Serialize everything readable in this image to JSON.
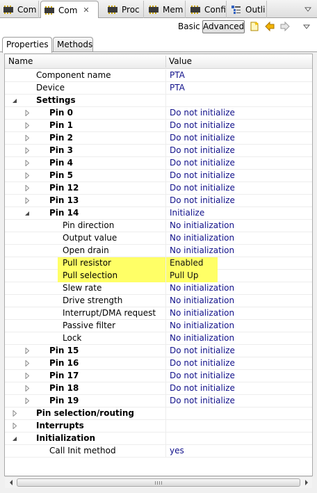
{
  "tabs": [
    {
      "label": "Com",
      "active": false
    },
    {
      "label": "Com",
      "active": true
    },
    {
      "label": "Proc",
      "active": false
    },
    {
      "label": "Mem",
      "active": false
    },
    {
      "label": "Confi",
      "active": false
    },
    {
      "label": "Outli",
      "active": false
    }
  ],
  "toolbar": {
    "basic_label": "Basic",
    "advanced_label": "Advanced"
  },
  "inner_tabs": [
    {
      "label": "Properties",
      "active": true
    },
    {
      "label": "Methods",
      "active": false
    }
  ],
  "table": {
    "columns": [
      "Name",
      "Value"
    ],
    "rows": [
      {
        "name": "Component name",
        "value": "PTA",
        "level": 1,
        "bold": false,
        "twisty": "none"
      },
      {
        "name": "Device",
        "value": "PTA",
        "level": 1,
        "bold": false,
        "twisty": "none"
      },
      {
        "name": "Settings",
        "value": "",
        "level": 1,
        "bold": true,
        "twisty": "expanded"
      },
      {
        "name": "Pin 0",
        "value": "Do not initialize",
        "level": 2,
        "bold": true,
        "twisty": "collapsed"
      },
      {
        "name": "Pin 1",
        "value": "Do not initialize",
        "level": 2,
        "bold": true,
        "twisty": "collapsed"
      },
      {
        "name": "Pin 2",
        "value": "Do not initialize",
        "level": 2,
        "bold": true,
        "twisty": "collapsed"
      },
      {
        "name": "Pin 3",
        "value": "Do not initialize",
        "level": 2,
        "bold": true,
        "twisty": "collapsed"
      },
      {
        "name": "Pin 4",
        "value": "Do not initialize",
        "level": 2,
        "bold": true,
        "twisty": "collapsed"
      },
      {
        "name": "Pin 5",
        "value": "Do not initialize",
        "level": 2,
        "bold": true,
        "twisty": "collapsed"
      },
      {
        "name": "Pin 12",
        "value": "Do not initialize",
        "level": 2,
        "bold": true,
        "twisty": "collapsed"
      },
      {
        "name": "Pin 13",
        "value": "Do not initialize",
        "level": 2,
        "bold": true,
        "twisty": "collapsed"
      },
      {
        "name": "Pin 14",
        "value": "Initialize",
        "level": 2,
        "bold": true,
        "twisty": "expanded"
      },
      {
        "name": "Pin direction",
        "value": "No initialization",
        "level": 3,
        "bold": false,
        "twisty": "none"
      },
      {
        "name": "Output value",
        "value": "No initialization",
        "level": 3,
        "bold": false,
        "twisty": "none"
      },
      {
        "name": "Open drain",
        "value": "No initialization",
        "level": 3,
        "bold": false,
        "twisty": "none"
      },
      {
        "name": "Pull resistor",
        "value": "Enabled",
        "level": 3,
        "bold": false,
        "twisty": "none",
        "highlight": true
      },
      {
        "name": "Pull selection",
        "value": "Pull Up",
        "level": 3,
        "bold": false,
        "twisty": "none",
        "highlight": true
      },
      {
        "name": "Slew rate",
        "value": "No initialization",
        "level": 3,
        "bold": false,
        "twisty": "none"
      },
      {
        "name": "Drive strength",
        "value": "No initialization",
        "level": 3,
        "bold": false,
        "twisty": "none"
      },
      {
        "name": "Interrupt/DMA request",
        "value": "No initialization",
        "level": 3,
        "bold": false,
        "twisty": "none"
      },
      {
        "name": "Passive filter",
        "value": "No initialization",
        "level": 3,
        "bold": false,
        "twisty": "none"
      },
      {
        "name": "Lock",
        "value": "No initialization",
        "level": 3,
        "bold": false,
        "twisty": "none"
      },
      {
        "name": "Pin 15",
        "value": "Do not initialize",
        "level": 2,
        "bold": true,
        "twisty": "collapsed"
      },
      {
        "name": "Pin 16",
        "value": "Do not initialize",
        "level": 2,
        "bold": true,
        "twisty": "collapsed"
      },
      {
        "name": "Pin 17",
        "value": "Do not initialize",
        "level": 2,
        "bold": true,
        "twisty": "collapsed"
      },
      {
        "name": "Pin 18",
        "value": "Do not initialize",
        "level": 2,
        "bold": true,
        "twisty": "collapsed"
      },
      {
        "name": "Pin 19",
        "value": "Do not initialize",
        "level": 2,
        "bold": true,
        "twisty": "collapsed"
      },
      {
        "name": "Pin selection/routing",
        "value": "",
        "level": 1,
        "bold": true,
        "twisty": "collapsed"
      },
      {
        "name": "Interrupts",
        "value": "",
        "level": 1,
        "bold": true,
        "twisty": "collapsed"
      },
      {
        "name": "Initialization",
        "value": "",
        "level": 1,
        "bold": true,
        "twisty": "expanded"
      },
      {
        "name": "Call Init method",
        "value": "yes",
        "level": 2,
        "bold": false,
        "twisty": "none"
      }
    ]
  },
  "colors": {
    "value_text": "#10108a",
    "highlight": "#ffff66"
  },
  "icons": [
    "chip-icon",
    "close-icon",
    "outline-icon",
    "view-menu-icon",
    "new-icon",
    "back-arrow-icon",
    "forward-arrow-icon",
    "expand-icon",
    "collapse-icon",
    "scroll-left-icon",
    "scroll-right-icon"
  ]
}
